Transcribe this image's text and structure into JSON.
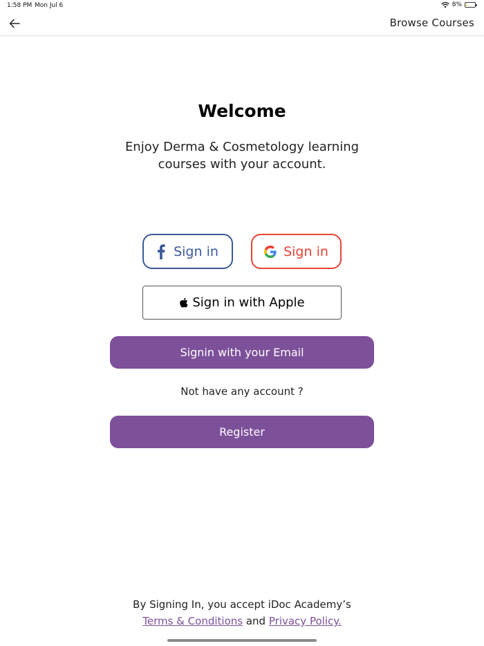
{
  "status_bar": {
    "time": "1:58 PM",
    "date": "Mon Jul 6",
    "battery": "8%",
    "wifi_icon": "wifi-icon",
    "battery_icon": "battery-charging-icon",
    "battery_level": 0.08
  },
  "nav": {
    "back_icon": "back-arrow-icon",
    "browse_label": "Browse Courses"
  },
  "welcome": {
    "title": "Welcome",
    "subtitle": "Enjoy Derma & Cosmetology learning courses with your account."
  },
  "social": {
    "facebook": {
      "icon": "facebook-icon",
      "label": "Sign in",
      "color": "#3b5998"
    },
    "google": {
      "icon": "google-icon",
      "label": "Sign in",
      "color": "#ea4335"
    },
    "apple": {
      "icon": "apple-icon",
      "label": "Sign in with Apple"
    }
  },
  "email_button": {
    "label": "Signin with your Email"
  },
  "no_account_text": "Not have any account ?",
  "register_button": {
    "label": "Register"
  },
  "accent_color": "#7d509a",
  "footer": {
    "prefix": "By Signing In, you accept iDoc Academy’s",
    "terms_label": "Terms & Conditions",
    "and": "and",
    "privacy_label": "Privacy Policy."
  }
}
